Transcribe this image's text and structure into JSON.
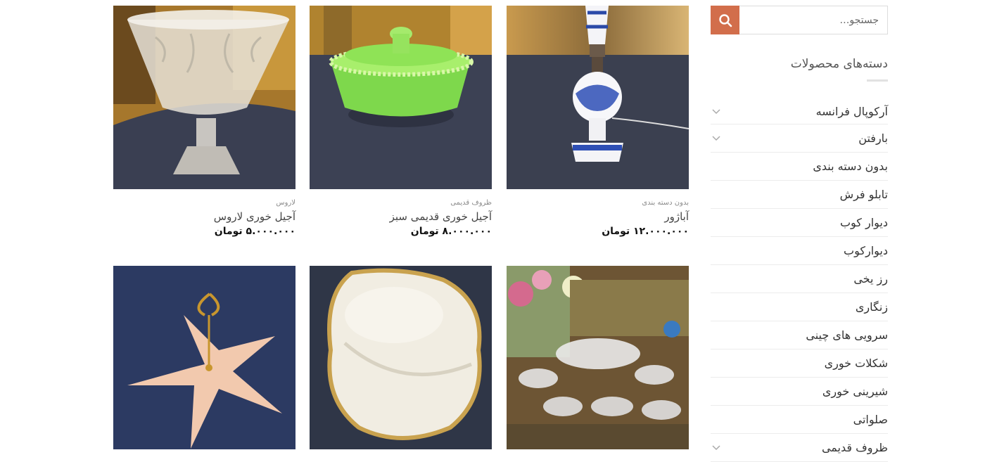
{
  "products": [
    {
      "category": "بدون دسته بندی",
      "title": "آباژور",
      "price": "۱۲.۰۰۰.۰۰۰ تومان"
    },
    {
      "category": "ظروف قدیمی",
      "title": "آجیل خوری قدیمی سبز",
      "price": "۸.۰۰۰.۰۰۰ تومان"
    },
    {
      "category": "لاروس",
      "title": "آجیل خوری لاروس",
      "price": "۵.۰۰۰.۰۰۰ تومان"
    }
  ],
  "sidebar": {
    "search_placeholder": "جستجو…",
    "widget_title": "دسته‌های محصولات",
    "categories": [
      {
        "label": "آرکوپال فرانسه"
      },
      {
        "label": "بارفتن"
      },
      {
        "label": "بدون دسته بندی"
      },
      {
        "label": "تابلو فرش"
      },
      {
        "label": "دیوار کوب"
      },
      {
        "label": "دیوارکوب"
      },
      {
        "label": "رز یخی"
      },
      {
        "label": "زنگاری"
      },
      {
        "label": "سرویی های چینی"
      },
      {
        "label": "شکلات خوری"
      },
      {
        "label": "شیرینی خوری"
      },
      {
        "label": "صلواتی"
      },
      {
        "label": "ظروف قدیمی"
      }
    ]
  },
  "colors": {
    "accent": "#d26e4b"
  },
  "icons": {
    "search": "search-icon",
    "expand": "chevron-down-icon"
  }
}
